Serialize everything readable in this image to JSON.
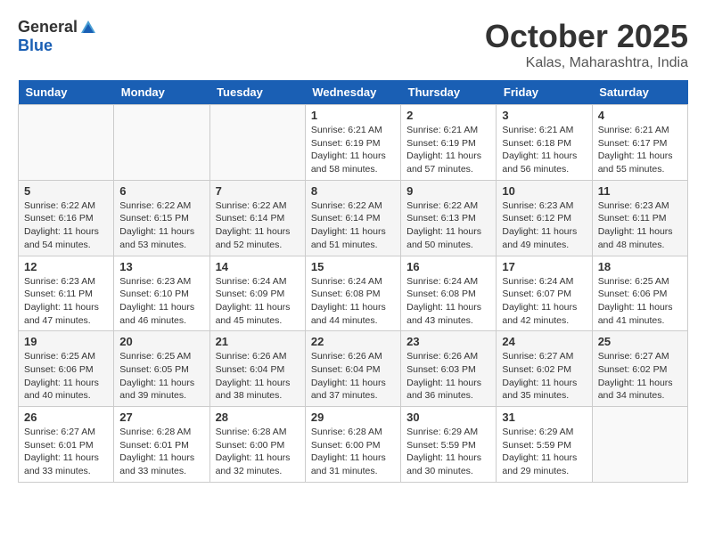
{
  "header": {
    "logo_general": "General",
    "logo_blue": "Blue",
    "month_title": "October 2025",
    "location": "Kalas, Maharashtra, India"
  },
  "weekdays": [
    "Sunday",
    "Monday",
    "Tuesday",
    "Wednesday",
    "Thursday",
    "Friday",
    "Saturday"
  ],
  "weeks": [
    [
      {
        "day": "",
        "sunrise": "",
        "sunset": "",
        "daylight": ""
      },
      {
        "day": "",
        "sunrise": "",
        "sunset": "",
        "daylight": ""
      },
      {
        "day": "",
        "sunrise": "",
        "sunset": "",
        "daylight": ""
      },
      {
        "day": "1",
        "sunrise": "Sunrise: 6:21 AM",
        "sunset": "Sunset: 6:19 PM",
        "daylight": "Daylight: 11 hours and 58 minutes."
      },
      {
        "day": "2",
        "sunrise": "Sunrise: 6:21 AM",
        "sunset": "Sunset: 6:19 PM",
        "daylight": "Daylight: 11 hours and 57 minutes."
      },
      {
        "day": "3",
        "sunrise": "Sunrise: 6:21 AM",
        "sunset": "Sunset: 6:18 PM",
        "daylight": "Daylight: 11 hours and 56 minutes."
      },
      {
        "day": "4",
        "sunrise": "Sunrise: 6:21 AM",
        "sunset": "Sunset: 6:17 PM",
        "daylight": "Daylight: 11 hours and 55 minutes."
      }
    ],
    [
      {
        "day": "5",
        "sunrise": "Sunrise: 6:22 AM",
        "sunset": "Sunset: 6:16 PM",
        "daylight": "Daylight: 11 hours and 54 minutes."
      },
      {
        "day": "6",
        "sunrise": "Sunrise: 6:22 AM",
        "sunset": "Sunset: 6:15 PM",
        "daylight": "Daylight: 11 hours and 53 minutes."
      },
      {
        "day": "7",
        "sunrise": "Sunrise: 6:22 AM",
        "sunset": "Sunset: 6:14 PM",
        "daylight": "Daylight: 11 hours and 52 minutes."
      },
      {
        "day": "8",
        "sunrise": "Sunrise: 6:22 AM",
        "sunset": "Sunset: 6:14 PM",
        "daylight": "Daylight: 11 hours and 51 minutes."
      },
      {
        "day": "9",
        "sunrise": "Sunrise: 6:22 AM",
        "sunset": "Sunset: 6:13 PM",
        "daylight": "Daylight: 11 hours and 50 minutes."
      },
      {
        "day": "10",
        "sunrise": "Sunrise: 6:23 AM",
        "sunset": "Sunset: 6:12 PM",
        "daylight": "Daylight: 11 hours and 49 minutes."
      },
      {
        "day": "11",
        "sunrise": "Sunrise: 6:23 AM",
        "sunset": "Sunset: 6:11 PM",
        "daylight": "Daylight: 11 hours and 48 minutes."
      }
    ],
    [
      {
        "day": "12",
        "sunrise": "Sunrise: 6:23 AM",
        "sunset": "Sunset: 6:11 PM",
        "daylight": "Daylight: 11 hours and 47 minutes."
      },
      {
        "day": "13",
        "sunrise": "Sunrise: 6:23 AM",
        "sunset": "Sunset: 6:10 PM",
        "daylight": "Daylight: 11 hours and 46 minutes."
      },
      {
        "day": "14",
        "sunrise": "Sunrise: 6:24 AM",
        "sunset": "Sunset: 6:09 PM",
        "daylight": "Daylight: 11 hours and 45 minutes."
      },
      {
        "day": "15",
        "sunrise": "Sunrise: 6:24 AM",
        "sunset": "Sunset: 6:08 PM",
        "daylight": "Daylight: 11 hours and 44 minutes."
      },
      {
        "day": "16",
        "sunrise": "Sunrise: 6:24 AM",
        "sunset": "Sunset: 6:08 PM",
        "daylight": "Daylight: 11 hours and 43 minutes."
      },
      {
        "day": "17",
        "sunrise": "Sunrise: 6:24 AM",
        "sunset": "Sunset: 6:07 PM",
        "daylight": "Daylight: 11 hours and 42 minutes."
      },
      {
        "day": "18",
        "sunrise": "Sunrise: 6:25 AM",
        "sunset": "Sunset: 6:06 PM",
        "daylight": "Daylight: 11 hours and 41 minutes."
      }
    ],
    [
      {
        "day": "19",
        "sunrise": "Sunrise: 6:25 AM",
        "sunset": "Sunset: 6:06 PM",
        "daylight": "Daylight: 11 hours and 40 minutes."
      },
      {
        "day": "20",
        "sunrise": "Sunrise: 6:25 AM",
        "sunset": "Sunset: 6:05 PM",
        "daylight": "Daylight: 11 hours and 39 minutes."
      },
      {
        "day": "21",
        "sunrise": "Sunrise: 6:26 AM",
        "sunset": "Sunset: 6:04 PM",
        "daylight": "Daylight: 11 hours and 38 minutes."
      },
      {
        "day": "22",
        "sunrise": "Sunrise: 6:26 AM",
        "sunset": "Sunset: 6:04 PM",
        "daylight": "Daylight: 11 hours and 37 minutes."
      },
      {
        "day": "23",
        "sunrise": "Sunrise: 6:26 AM",
        "sunset": "Sunset: 6:03 PM",
        "daylight": "Daylight: 11 hours and 36 minutes."
      },
      {
        "day": "24",
        "sunrise": "Sunrise: 6:27 AM",
        "sunset": "Sunset: 6:02 PM",
        "daylight": "Daylight: 11 hours and 35 minutes."
      },
      {
        "day": "25",
        "sunrise": "Sunrise: 6:27 AM",
        "sunset": "Sunset: 6:02 PM",
        "daylight": "Daylight: 11 hours and 34 minutes."
      }
    ],
    [
      {
        "day": "26",
        "sunrise": "Sunrise: 6:27 AM",
        "sunset": "Sunset: 6:01 PM",
        "daylight": "Daylight: 11 hours and 33 minutes."
      },
      {
        "day": "27",
        "sunrise": "Sunrise: 6:28 AM",
        "sunset": "Sunset: 6:01 PM",
        "daylight": "Daylight: 11 hours and 33 minutes."
      },
      {
        "day": "28",
        "sunrise": "Sunrise: 6:28 AM",
        "sunset": "Sunset: 6:00 PM",
        "daylight": "Daylight: 11 hours and 32 minutes."
      },
      {
        "day": "29",
        "sunrise": "Sunrise: 6:28 AM",
        "sunset": "Sunset: 6:00 PM",
        "daylight": "Daylight: 11 hours and 31 minutes."
      },
      {
        "day": "30",
        "sunrise": "Sunrise: 6:29 AM",
        "sunset": "Sunset: 5:59 PM",
        "daylight": "Daylight: 11 hours and 30 minutes."
      },
      {
        "day": "31",
        "sunrise": "Sunrise: 6:29 AM",
        "sunset": "Sunset: 5:59 PM",
        "daylight": "Daylight: 11 hours and 29 minutes."
      },
      {
        "day": "",
        "sunrise": "",
        "sunset": "",
        "daylight": ""
      }
    ]
  ]
}
